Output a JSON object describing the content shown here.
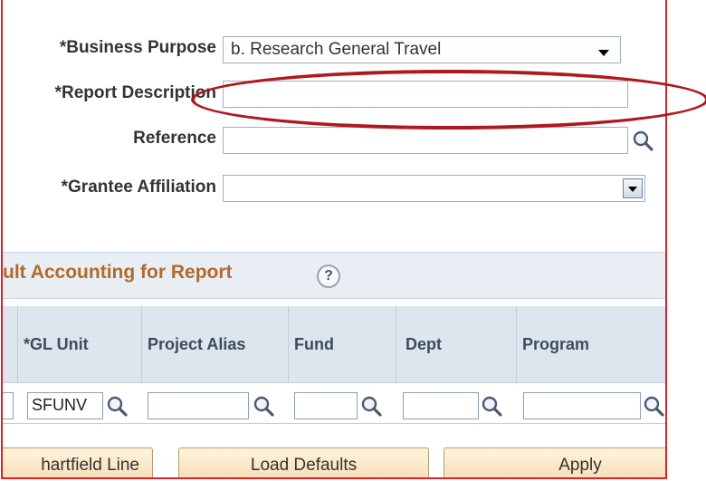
{
  "form": {
    "business_purpose_label": "*Business Purpose",
    "business_purpose_value": "b. Research General Travel",
    "report_description_label": "*Report Description",
    "report_description_value": "",
    "reference_label": "Reference",
    "reference_value": "",
    "grantee_affiliation_label": "*Grantee Affiliation",
    "grantee_affiliation_value": ""
  },
  "section": {
    "title": "ult Accounting for Report",
    "help_glyph": "?"
  },
  "grid": {
    "columns": [
      "",
      "*GL Unit",
      "Project Alias",
      "Fund",
      "Dept",
      "Program"
    ],
    "row": {
      "gl_unit": "SFUNV",
      "project_alias": "",
      "fund": "",
      "dept": "",
      "program": ""
    }
  },
  "buttons": {
    "chartfield_line": "hartfield Line",
    "load_defaults": "Load Defaults",
    "apply": "Apply"
  },
  "annotation": {
    "color": "#b0181e"
  },
  "colors": {
    "frame": "#d8232a",
    "section_title": "#b4692a",
    "grid_header_bg": "#dde6ef"
  }
}
